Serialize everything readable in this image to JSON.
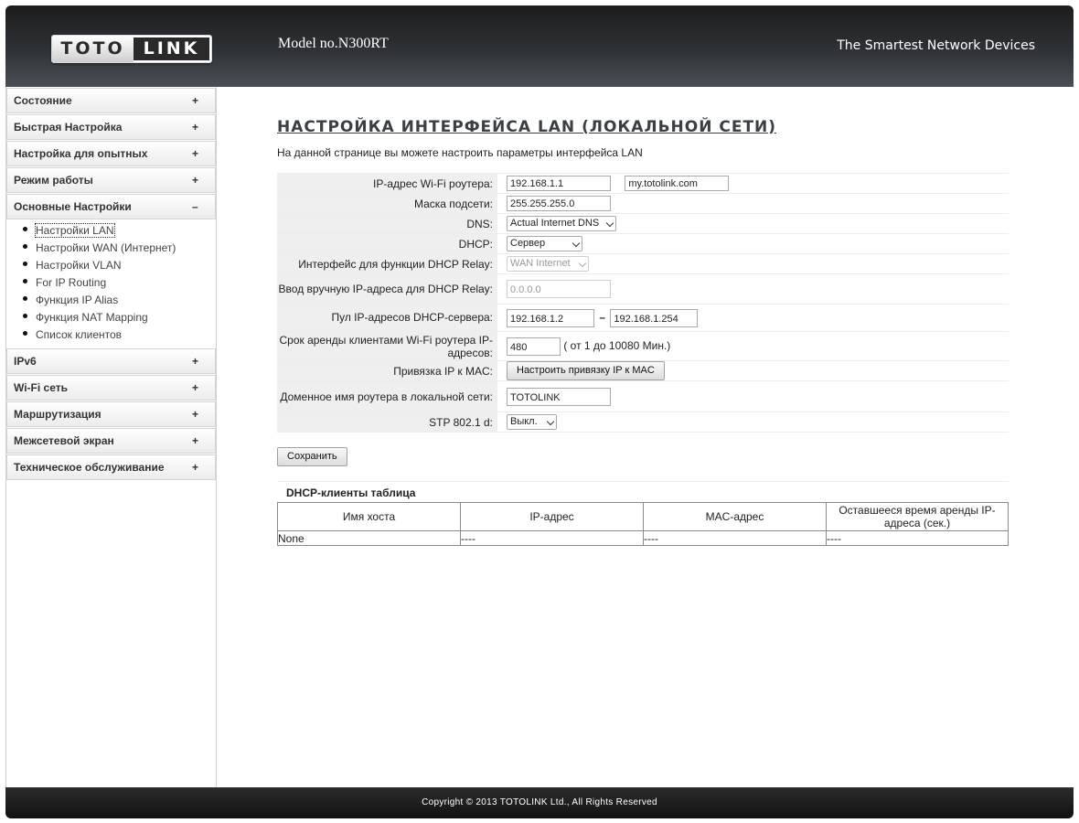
{
  "header": {
    "logo_left": "TOTO",
    "logo_right": "LINK",
    "model": "Model no.N300RT",
    "tagline": "The Smartest Network Devices"
  },
  "sidebar": {
    "items_top": [
      {
        "label": "Состояние",
        "sign": "+"
      },
      {
        "label": "Быстрая Настройка",
        "sign": "+"
      },
      {
        "label": "Настройка для опытных",
        "sign": "+"
      },
      {
        "label": "Режим работы",
        "sign": "+"
      },
      {
        "label": "Основные Настройки",
        "sign": "–"
      }
    ],
    "submenu": [
      "Настройки LAN",
      "Настройки WAN (Интернет)",
      "Настройки VLAN",
      "For IP Routing",
      "Функция IP Alias",
      "Функция NAT Mapping",
      "Список клиентов"
    ],
    "items_bottom": [
      {
        "label": "IPv6",
        "sign": "+"
      },
      {
        "label": "Wi-Fi сеть",
        "sign": "+"
      },
      {
        "label": "Маршрутизация",
        "sign": "+"
      },
      {
        "label": "Межсетевой экран",
        "sign": "+"
      },
      {
        "label": "Техническое обслуживание",
        "sign": "+"
      }
    ]
  },
  "main": {
    "title": "НАСТРОЙКА ИНТЕРФЕЙСА LAN (ЛОКАЛЬНОЙ СЕТИ)",
    "description": "На данной странице вы можете настроить параметры интерфейса LAN",
    "fields": {
      "ip_label": "IP-адрес Wi-Fi роутера:",
      "ip_value": "192.168.1.1",
      "domain_value": "my.totolink.com",
      "mask_label": "Маска подсети:",
      "mask_value": "255.255.255.0",
      "dns_label": "DNS:",
      "dns_value": "Actual Internet DNS",
      "dhcp_label": "DHCP:",
      "dhcp_value": "Сервер",
      "relay_if_label": "Интерфейс для функции DHCP Relay:",
      "relay_if_value": "WAN Internet",
      "relay_ip_label": "Ввод вручную IP-адреса для DHCP Relay:",
      "relay_ip_value": "0.0.0.0",
      "pool_label": "Пул IP-адресов DHCP-сервера:",
      "pool_start": "192.168.1.2",
      "pool_sep": "–",
      "pool_end": "192.168.1.254",
      "lease_label": "Срок аренды клиентами Wi-Fi роутера IP-адресов:",
      "lease_value": "480",
      "lease_hint": "( от 1 до 10080 Мин.)",
      "binding_label": "Привязка IP к MAC:",
      "binding_button": "Настроить привязку IP к MAC",
      "hostname_label": "Доменное имя роутера в локальной сети:",
      "hostname_value": "TOTOLINK",
      "stp_label": "STP 802.1 d:",
      "stp_value": "Выкл."
    },
    "save_button": "Сохранить",
    "dhcp_table": {
      "title": "DHCP-клиенты таблица",
      "columns": [
        "Имя хоста",
        "IP-адрес",
        "MAC-адрес",
        "Оставшееся время аренды IP-адреса (сек.)"
      ],
      "rows": [
        [
          "None",
          "----",
          "----",
          "----"
        ]
      ]
    }
  },
  "footer": {
    "copyright": "Copyright © 2013 TOTOLINK Ltd.,   All Rights Reserved"
  }
}
